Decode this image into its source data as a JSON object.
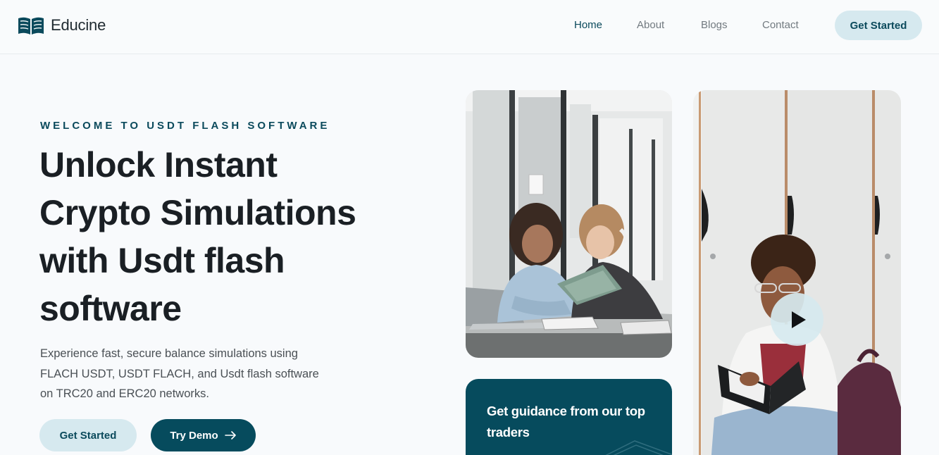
{
  "header": {
    "logo_text": "Educine",
    "nav": [
      {
        "label": "Home",
        "active": true
      },
      {
        "label": "About",
        "active": false
      },
      {
        "label": "Blogs",
        "active": false
      },
      {
        "label": "Contact",
        "active": false
      }
    ],
    "cta_label": "Get Started"
  },
  "hero": {
    "eyebrow": "WELCOME TO USDT FLASH SOFTWARE",
    "headline_lines": [
      "Unlock Instant",
      "Crypto Simulations",
      "with Usdt flash",
      "software"
    ],
    "description_lines": [
      "Experience fast, secure balance simulations using",
      "FLACH USDT, USDT FLACH, and Usdt flash software",
      "on TRC20 and ERC20 networks."
    ],
    "primary_button": "Get Started",
    "secondary_button": "Try Demo"
  },
  "cards": {
    "guidance_title": "Get guidance from our top traders"
  },
  "icons": {
    "logo": "open-book-icon",
    "secondary_button": "arrow-right-icon",
    "video": "play-icon"
  },
  "colors": {
    "brand_dark": "#064b5d",
    "brand_light": "#d6e9ef",
    "text_dark": "#1a1f24",
    "background": "#f8fafc"
  }
}
